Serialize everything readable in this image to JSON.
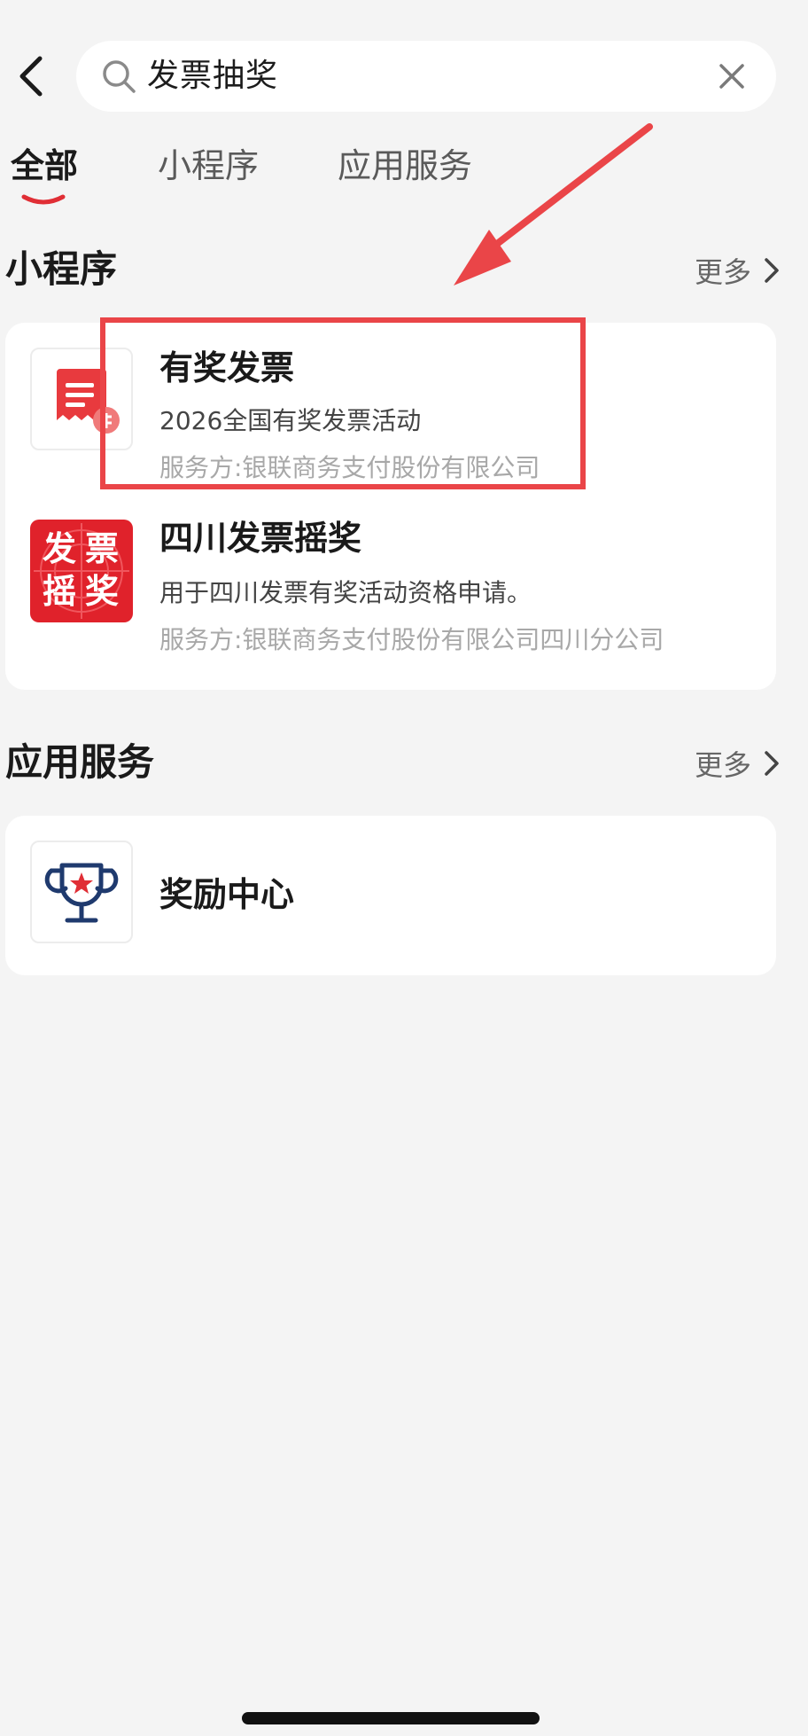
{
  "header": {
    "search_query": "发票抽奖"
  },
  "tabs": [
    {
      "label": "全部",
      "active": true
    },
    {
      "label": "小程序",
      "active": false
    },
    {
      "label": "应用服务",
      "active": false
    }
  ],
  "mini_programs": {
    "title": "小程序",
    "more_label": "更多",
    "items": [
      {
        "name": "有奖发票",
        "description": "2026全国有奖发票活动",
        "provider": "服务方:银联商务支付股份有限公司",
        "icon": "receipt-icon"
      },
      {
        "name": "四川发票摇奖",
        "description": "用于四川发票有奖活动资格申请。",
        "provider": "服务方:银联商务支付股份有限公司四川分公司",
        "icon": "invoice-lottery-icon",
        "icon_chars": [
          "发",
          "票",
          "摇",
          "奖"
        ]
      }
    ]
  },
  "services": {
    "title": "应用服务",
    "more_label": "更多",
    "items": [
      {
        "name": "奖励中心",
        "icon": "trophy-icon"
      }
    ]
  },
  "colors": {
    "accent": "#e02e35",
    "annotation": "#ea4548",
    "background": "#f4f4f4"
  }
}
